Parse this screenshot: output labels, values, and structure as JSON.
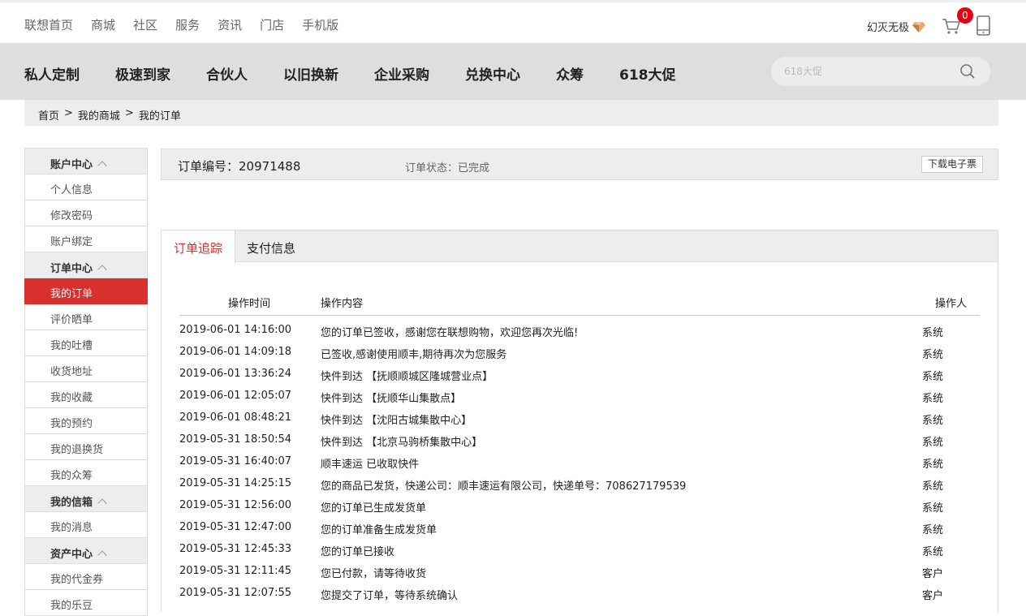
{
  "topnav": [
    "联想首页",
    "商城",
    "社区",
    "服务",
    "资讯",
    "门店",
    "手机版"
  ],
  "user": {
    "name": "幻灭无极"
  },
  "cart": {
    "count": "0"
  },
  "mainnav": [
    "私人定制",
    "极速到家",
    "合伙人",
    "以旧换新",
    "企业采购",
    "兑换中心",
    "众筹",
    "618大促"
  ],
  "search": {
    "placeholder": "618大促"
  },
  "breadcrumb": [
    "首页",
    ">",
    "我的商城",
    ">",
    "我的订单"
  ],
  "sidebar": [
    {
      "type": "group",
      "label": "账户中心"
    },
    {
      "type": "item",
      "label": "个人信息"
    },
    {
      "type": "item",
      "label": "修改密码"
    },
    {
      "type": "item",
      "label": "账户绑定"
    },
    {
      "type": "group",
      "label": "订单中心"
    },
    {
      "type": "item",
      "label": "我的订单",
      "active": true
    },
    {
      "type": "item",
      "label": "评价晒单"
    },
    {
      "type": "item",
      "label": "我的吐槽"
    },
    {
      "type": "item",
      "label": "收货地址"
    },
    {
      "type": "item",
      "label": "我的收藏"
    },
    {
      "type": "item",
      "label": "我的预约"
    },
    {
      "type": "item",
      "label": "我的退换货"
    },
    {
      "type": "item",
      "label": "我的众筹"
    },
    {
      "type": "group",
      "label": "我的信箱"
    },
    {
      "type": "item",
      "label": "我的消息"
    },
    {
      "type": "group",
      "label": "资产中心"
    },
    {
      "type": "item",
      "label": "我的代金券"
    },
    {
      "type": "item",
      "label": "我的乐豆"
    }
  ],
  "order": {
    "number_label": "订单编号：",
    "number": "20971488",
    "status_label": "订单状态：",
    "status": "已完成",
    "download_label": "下载电子票"
  },
  "tabs": [
    "订单追踪",
    "支付信息"
  ],
  "tracking": {
    "headers": {
      "time": "操作时间",
      "content": "操作内容",
      "operator": "操作人"
    },
    "rows": [
      {
        "time": "2019-06-01 14:16:00",
        "content": "您的订单已签收，感谢您在联想购物，欢迎您再次光临!",
        "operator": "系统"
      },
      {
        "time": "2019-06-01 14:09:18",
        "content": "已签收,感谢使用顺丰,期待再次为您服务",
        "operator": "系统"
      },
      {
        "time": "2019-06-01 13:36:24",
        "content": "快件到达 【抚顺顺城区隆城营业点】",
        "operator": "系统"
      },
      {
        "time": "2019-06-01 12:05:07",
        "content": "快件到达 【抚顺华山集散点】",
        "operator": "系统"
      },
      {
        "time": "2019-06-01 08:48:21",
        "content": "快件到达 【沈阳古城集散中心】",
        "operator": "系统"
      },
      {
        "time": "2019-05-31 18:50:54",
        "content": "快件到达 【北京马驹桥集散中心】",
        "operator": "系统"
      },
      {
        "time": "2019-05-31 16:40:07",
        "content": "顺丰速运 已收取快件",
        "operator": "系统"
      },
      {
        "time": "2019-05-31 14:25:15",
        "content": "您的商品已发货，快递公司：顺丰速运有限公司，快递单号：708627179539",
        "operator": "系统"
      },
      {
        "time": "2019-05-31 12:56:00",
        "content": "您的订单已生成发货单",
        "operator": "系统"
      },
      {
        "time": "2019-05-31 12:47:00",
        "content": "您的订单准备生成发货单",
        "operator": "系统"
      },
      {
        "time": "2019-05-31 12:45:33",
        "content": "您的订单已接收",
        "operator": "系统"
      },
      {
        "time": "2019-05-31 12:11:45",
        "content": "您已付款，请等待收货",
        "operator": "客户"
      },
      {
        "time": "2019-05-31 12:07:55",
        "content": "您提交了订单，等待系统确认",
        "operator": "客户"
      }
    ]
  },
  "colors": {
    "accent": "#d8302d",
    "badge": "#e60012"
  }
}
